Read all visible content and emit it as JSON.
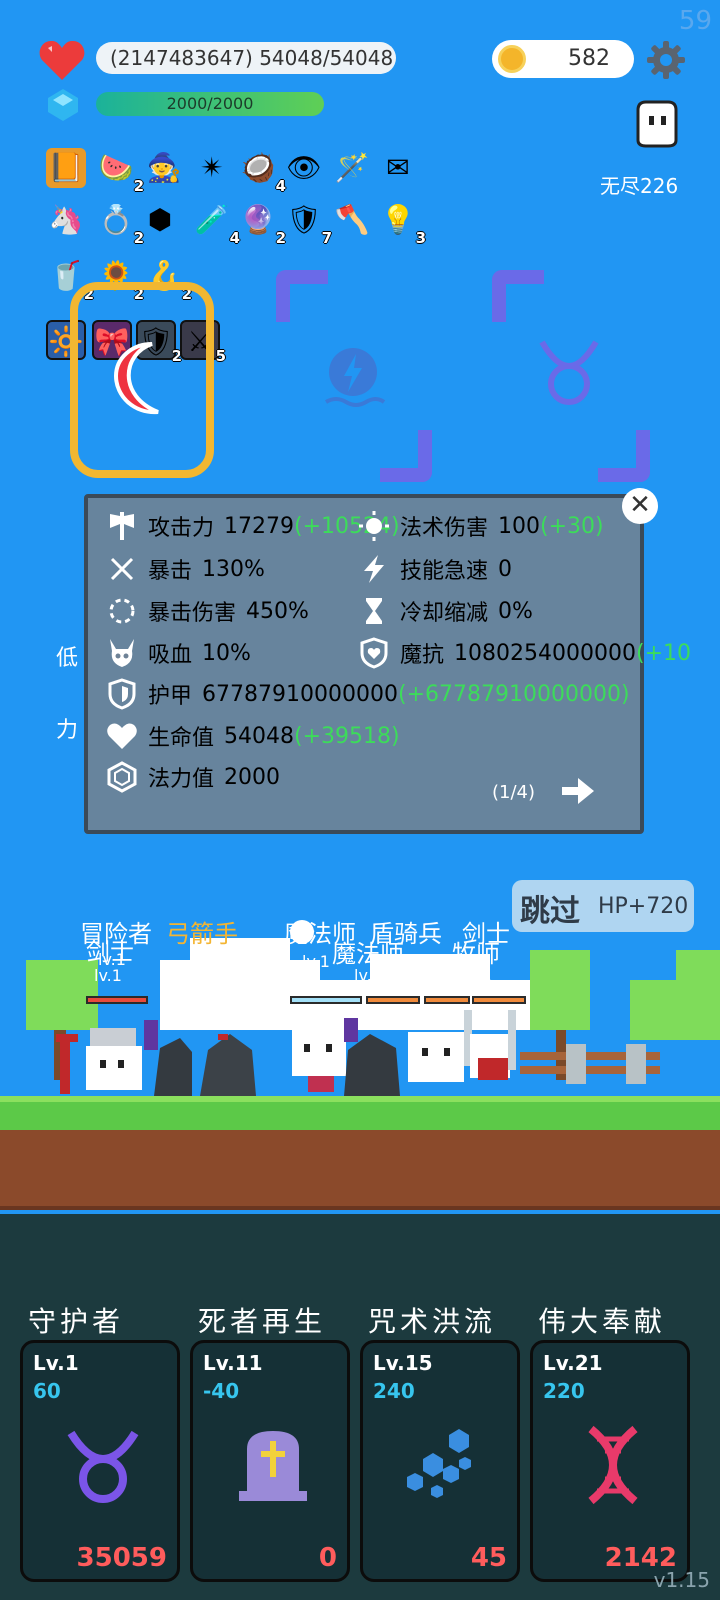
{
  "fps": "59",
  "hud": {
    "hp_text": "(2147483647) 54048/54048",
    "mp_text": "2000/2000",
    "coins": "582",
    "endless_label": "无尽226"
  },
  "items": [
    {
      "icon": "book-icon",
      "glyph": "📙",
      "count": ""
    },
    {
      "icon": "watermelon-icon",
      "glyph": "🍉",
      "count": "2"
    },
    {
      "icon": "wizard-hat-icon",
      "glyph": "🧙",
      "count": ""
    },
    {
      "icon": "spiked-club-icon",
      "glyph": "✴",
      "count": ""
    },
    {
      "icon": "coconut-icon",
      "glyph": "🥥",
      "count": "4"
    },
    {
      "icon": "eye-charm-icon",
      "glyph": "👁",
      "count": ""
    },
    {
      "icon": "magic-wand-icon",
      "glyph": "🪄",
      "count": ""
    },
    {
      "icon": "envelope-icon",
      "glyph": "✉",
      "count": ""
    },
    {
      "icon": "unicorn-icon",
      "glyph": "🦄",
      "count": ""
    },
    {
      "icon": "ring-icon",
      "glyph": "💍",
      "count": "2"
    },
    {
      "icon": "blue-gem-icon",
      "glyph": "⬢",
      "count": ""
    },
    {
      "icon": "potion-icon",
      "glyph": "🧪",
      "count": "4"
    },
    {
      "icon": "crystal-ball-icon",
      "glyph": "🔮",
      "count": "2"
    },
    {
      "icon": "shield-badge-icon",
      "glyph": "🛡",
      "count": "7"
    },
    {
      "icon": "battle-axe-icon",
      "glyph": "🪓",
      "count": ""
    },
    {
      "icon": "lightbulb-icon",
      "glyph": "💡",
      "count": "3"
    },
    {
      "icon": "coconut-drink-icon",
      "glyph": "🥤",
      "count": "2"
    },
    {
      "icon": "sunflower-icon",
      "glyph": "🌻",
      "count": "2"
    },
    {
      "icon": "hook-icon",
      "glyph": "🪝",
      "count": "2"
    },
    {
      "icon": "light-tile-icon",
      "glyph": "🔆",
      "count": ""
    },
    {
      "icon": "pink-tile-icon",
      "glyph": "🎀",
      "count": ""
    },
    {
      "icon": "armor-tile-icon",
      "glyph": "🛡",
      "count": "2"
    },
    {
      "icon": "sword-tile-icon",
      "glyph": "⚔",
      "count": "5"
    }
  ],
  "stats": {
    "attack_label": "攻击力",
    "attack_value": "17279",
    "attack_bonus": "(+10524)",
    "magic_label": "法术伤害",
    "magic_value": "100",
    "magic_bonus": "(+30)",
    "crit_label": "暴击",
    "crit_value": "130%",
    "haste_label": "技能急速",
    "haste_value": "0",
    "critdmg_label": "暴击伤害",
    "critdmg_value": "450%",
    "cdr_label": "冷却缩减",
    "cdr_value": "0%",
    "lifesteal_label": "吸血",
    "lifesteal_value": "10%",
    "mres_label": "魔抗",
    "mres_value": "1080254000000",
    "mres_bonus": "(+10",
    "armor_label": "护甲",
    "armor_value": "67787910000000",
    "armor_bonus": "(+67787910000000)",
    "hp_label": "生命值",
    "hp_value": "54048",
    "hp_bonus": "(+39518)",
    "mp_label": "法力值",
    "mp_value": "2000",
    "page": "(1/4)"
  },
  "side_texts": [
    "低",
    "力"
  ],
  "skip": {
    "label": "跳过",
    "hp": "HP+720"
  },
  "units": {
    "adventurer": "冒险者",
    "swordsman": "剑士",
    "archer": "弓箭手",
    "mage": "魔法师",
    "shield": "盾骑兵",
    "swordsman2": "剑士",
    "mage2": "魔法师",
    "priest": "牧师",
    "lv": "lv.1"
  },
  "skills": [
    {
      "name": "守护者",
      "lv": "Lv.1",
      "value": "60",
      "cost": "35059",
      "icon": "taurus-icon",
      "color": "#7b55e8"
    },
    {
      "name": "死者再生",
      "lv": "Lv.11",
      "value": "-40",
      "cost": "0",
      "icon": "tombstone-icon",
      "color": "#9a8ad8"
    },
    {
      "name": "咒术洪流",
      "lv": "Lv.15",
      "value": "240",
      "cost": "45",
      "icon": "hexagons-icon",
      "color": "#3a8ee0"
    },
    {
      "name": "伟大奉献",
      "lv": "Lv.21",
      "value": "220",
      "cost": "2142",
      "icon": "dna-icon",
      "color": "#e83a6a"
    }
  ],
  "version": "v1.15"
}
